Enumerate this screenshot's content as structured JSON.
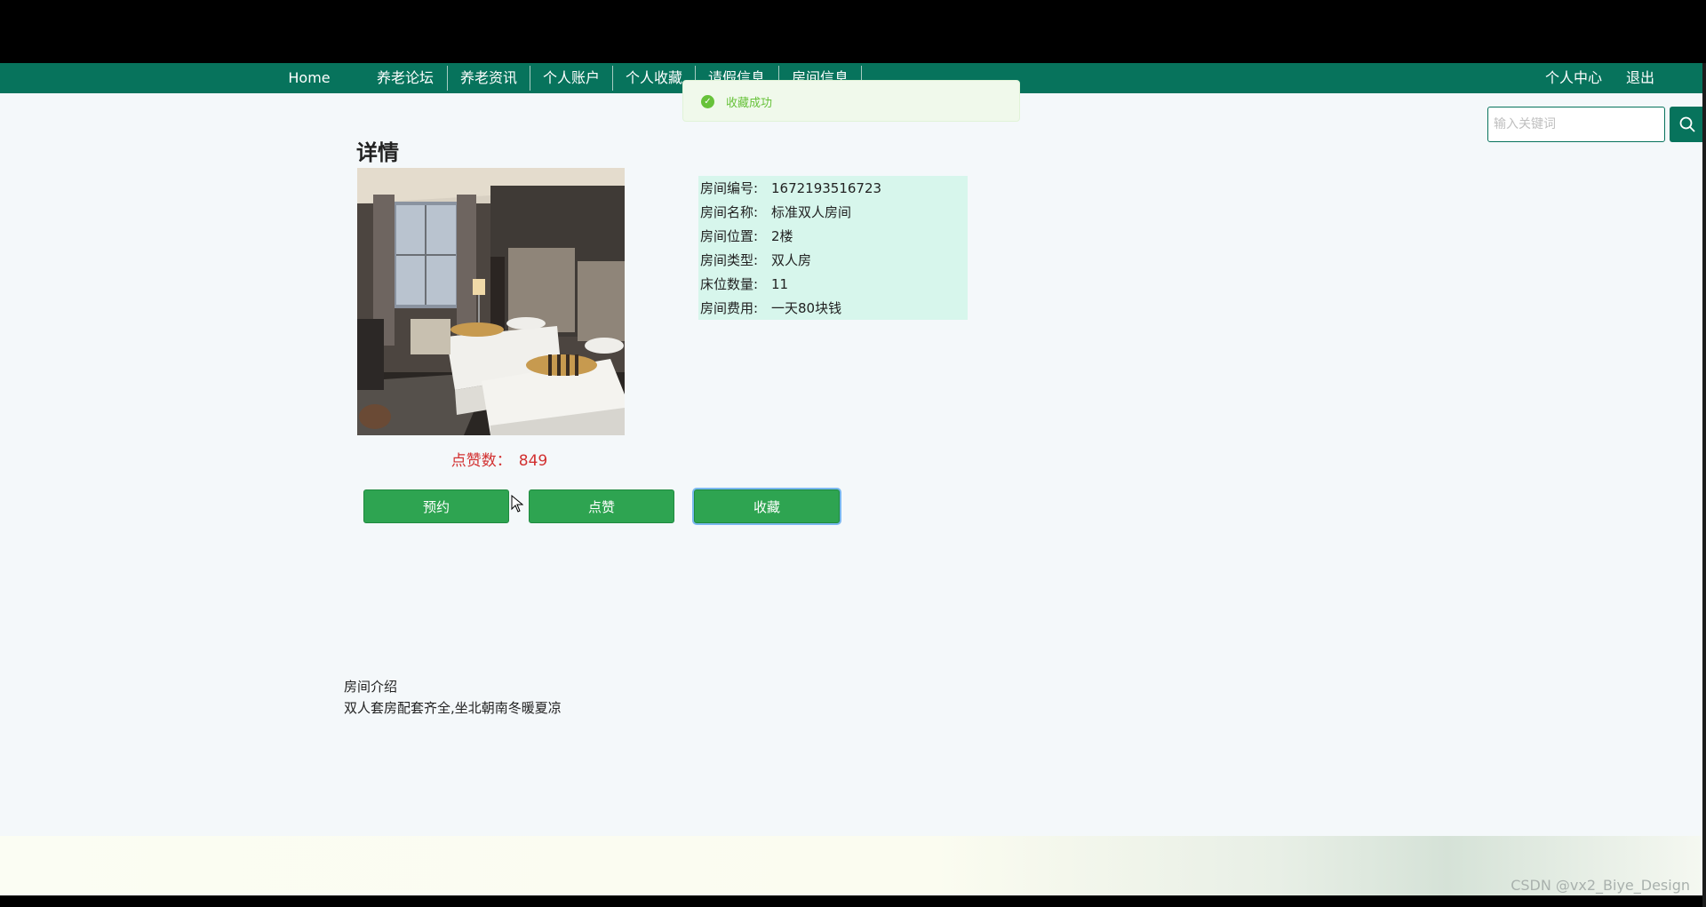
{
  "nav": {
    "home": "Home",
    "forum": "养老论坛",
    "news": "养老资讯",
    "account": "个人账户",
    "favorites": "个人收藏",
    "leave": "请假信息",
    "rooms": "房间信息",
    "personal_center": "个人中心",
    "logout": "退出"
  },
  "toast": {
    "message": "收藏成功",
    "icon": "check-circle-icon"
  },
  "search": {
    "placeholder": "输入关键词",
    "icon": "search-icon"
  },
  "detail": {
    "title": "详情",
    "likes_label": "点赞数：",
    "likes_value": "849",
    "fields": [
      {
        "label": "房间编号:",
        "value": "1672193516723"
      },
      {
        "label": "房间名称:",
        "value": "标准双人房间"
      },
      {
        "label": "房间位置:",
        "value": "2楼"
      },
      {
        "label": "房间类型:",
        "value": "双人房"
      },
      {
        "label": "床位数量:",
        "value": "11"
      },
      {
        "label": "房间费用:",
        "value": "一天80块钱"
      }
    ]
  },
  "actions": {
    "reserve": "预约",
    "like": "点赞",
    "favorite": "收藏"
  },
  "intro": {
    "title": "房间介绍",
    "text": "双人套房配套齐全,坐北朝南冬暖夏凉"
  },
  "watermark": "CSDN @vx2_Biye_Design",
  "colors": {
    "nav_bg": "#07735c",
    "button_bg": "#2ea451",
    "info_bg": "#d7f6ec",
    "likes_text": "#d23131",
    "toast_text": "#67c23a"
  }
}
